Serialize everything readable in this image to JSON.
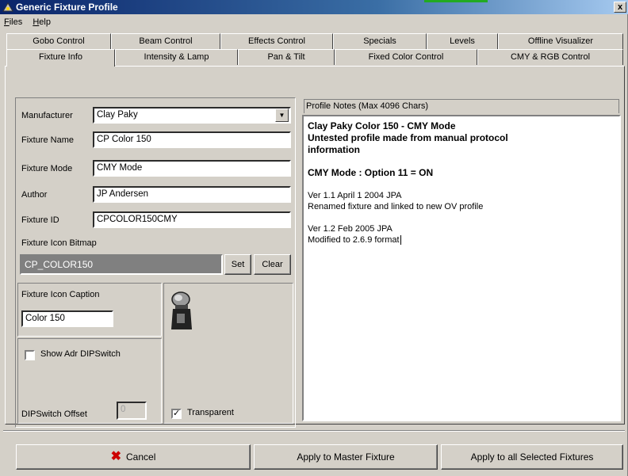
{
  "window": {
    "title": "Generic Fixture Profile",
    "close": "x"
  },
  "menu": [
    {
      "label": "Files",
      "accel": "F",
      "rest": "iles"
    },
    {
      "label": "Help",
      "accel": "H",
      "rest": "elp"
    }
  ],
  "tabs_back": [
    "Gobo Control",
    "Beam Control",
    "Effects Control",
    "Specials",
    "Levels",
    "Offline Visualizer"
  ],
  "tabs_front": [
    "Fixture Info",
    "Intensity & Lamp",
    "Pan & Tilt",
    "Fixed Color Control",
    "CMY & RGB Control"
  ],
  "active_tab": "Fixture Info",
  "form": {
    "manufacturer_label": "Manufacturer",
    "manufacturer_value": "Clay Paky",
    "fixture_name_label": "Fixture Name",
    "fixture_name_value": "CP Color 150",
    "fixture_mode_label": "Fixture Mode",
    "fixture_mode_value": "CMY Mode",
    "author_label": "Author",
    "author_value": "JP Andersen",
    "fixture_id_label": "Fixture ID",
    "fixture_id_value": "CPCOLOR150CMY",
    "icon_bitmap_label": "Fixture Icon Bitmap",
    "icon_bitmap_value": "CP_COLOR150",
    "set_label": "Set",
    "clear_label": "Clear",
    "icon_caption_label": "Fixture Icon Caption",
    "icon_caption_value": "Color 150",
    "show_adr_label": "Show Adr DIPSwitch",
    "dip_offset_label": "DIPSwitch Offset",
    "dip_offset_value": "0",
    "transparent_label": "Transparent",
    "transparent_checked": true
  },
  "notes": {
    "header": "Profile Notes (Max 4096 Chars)",
    "lines": [
      {
        "text": "Clay Paky Color 150 - CMY Mode",
        "bold": true
      },
      {
        "text": "Untested profile made from manual protocol",
        "bold": true
      },
      {
        "text": "information",
        "bold": true
      },
      {
        "text": "",
        "bold": false
      },
      {
        "text": "CMY Mode : Option 11 = ON",
        "bold": true
      },
      {
        "text": "",
        "bold": false
      },
      {
        "text": "Ver 1.1 April 1 2004 JPA",
        "bold": false
      },
      {
        "text": "Renamed fixture and linked to new OV profile",
        "bold": false
      },
      {
        "text": "",
        "bold": false
      },
      {
        "text": "Ver 1.2 Feb 2005 JPA",
        "bold": false
      },
      {
        "text": "Modified to 2.6.9 format",
        "bold": false
      }
    ]
  },
  "buttons": {
    "cancel": "Cancel",
    "apply_master": "Apply to Master Fixture",
    "apply_all": "Apply to all Selected Fixtures"
  }
}
